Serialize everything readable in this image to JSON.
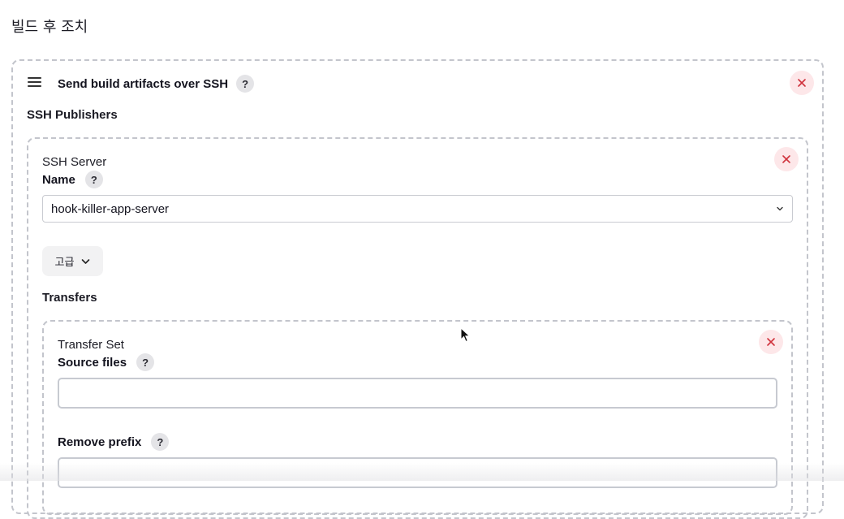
{
  "section": {
    "title": "빌드 후 조치"
  },
  "builder": {
    "title": "Send build artifacts over SSH",
    "help": "?",
    "publishers_label": "SSH Publishers"
  },
  "server": {
    "heading": "SSH Server",
    "name_label": "Name",
    "name_help": "?",
    "name_value": "hook-killer-app-server",
    "advanced_label": "고급",
    "transfers_label": "Transfers"
  },
  "transfer_set": {
    "heading": "Transfer Set",
    "source_files_label": "Source files",
    "source_files_help": "?",
    "source_files_value": "",
    "remove_prefix_label": "Remove prefix",
    "remove_prefix_help": "?",
    "remove_prefix_value": ""
  },
  "icons": {
    "close": "close-icon",
    "drag": "drag-handle-icon",
    "chevron": "chevron-down-icon",
    "help": "question-icon"
  },
  "colors": {
    "close_bg": "#fde7e9",
    "close_x": "#d0333d",
    "dashed_border": "#c3c5cc",
    "help_bg": "#e4e4e7"
  }
}
